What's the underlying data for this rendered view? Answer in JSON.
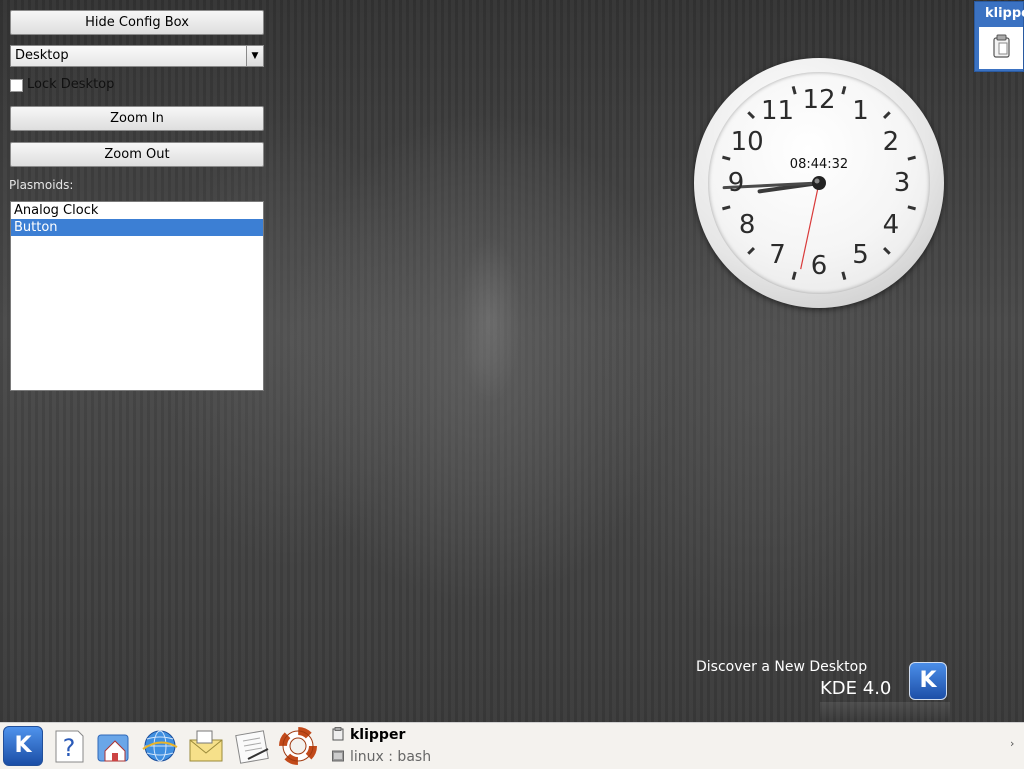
{
  "config": {
    "hide_config_label": "Hide Config Box",
    "containment_select": "Desktop",
    "lock_desktop_label": "Lock Desktop",
    "zoom_in_label": "Zoom In",
    "zoom_out_label": "Zoom Out",
    "plasmoids_label": "Plasmoids:",
    "plasmoids": [
      {
        "label": "Analog Clock",
        "selected": false
      },
      {
        "label": "Button",
        "selected": true
      }
    ]
  },
  "clock": {
    "digital_time": "08:44:32",
    "numerals": [
      "12",
      "1",
      "2",
      "3",
      "4",
      "5",
      "6",
      "7",
      "8",
      "9",
      "10",
      "11"
    ],
    "hours": 8,
    "minutes": 44,
    "seconds": 32
  },
  "klipper_applet": {
    "title": "klipper",
    "icon": "clipboard-icon"
  },
  "branding": {
    "line1": "Discover a New Desktop",
    "line2": "KDE 4.0",
    "logo_letter": "K"
  },
  "panel": {
    "kmenu_letter": "K",
    "launchers": [
      "help-icon",
      "home-folder-icon",
      "web-browser-icon",
      "mail-icon",
      "text-editor-icon",
      "lifebuoy-icon"
    ],
    "tasks": [
      {
        "label": "klipper",
        "active": true,
        "icon": "clipboard-icon"
      },
      {
        "label": "linux : bash",
        "active": false,
        "icon": "terminal-icon"
      }
    ]
  },
  "colors": {
    "selection": "#3c7fd4",
    "kde_blue": "#2a62c0",
    "panel_bg": "#f4f2ee"
  }
}
